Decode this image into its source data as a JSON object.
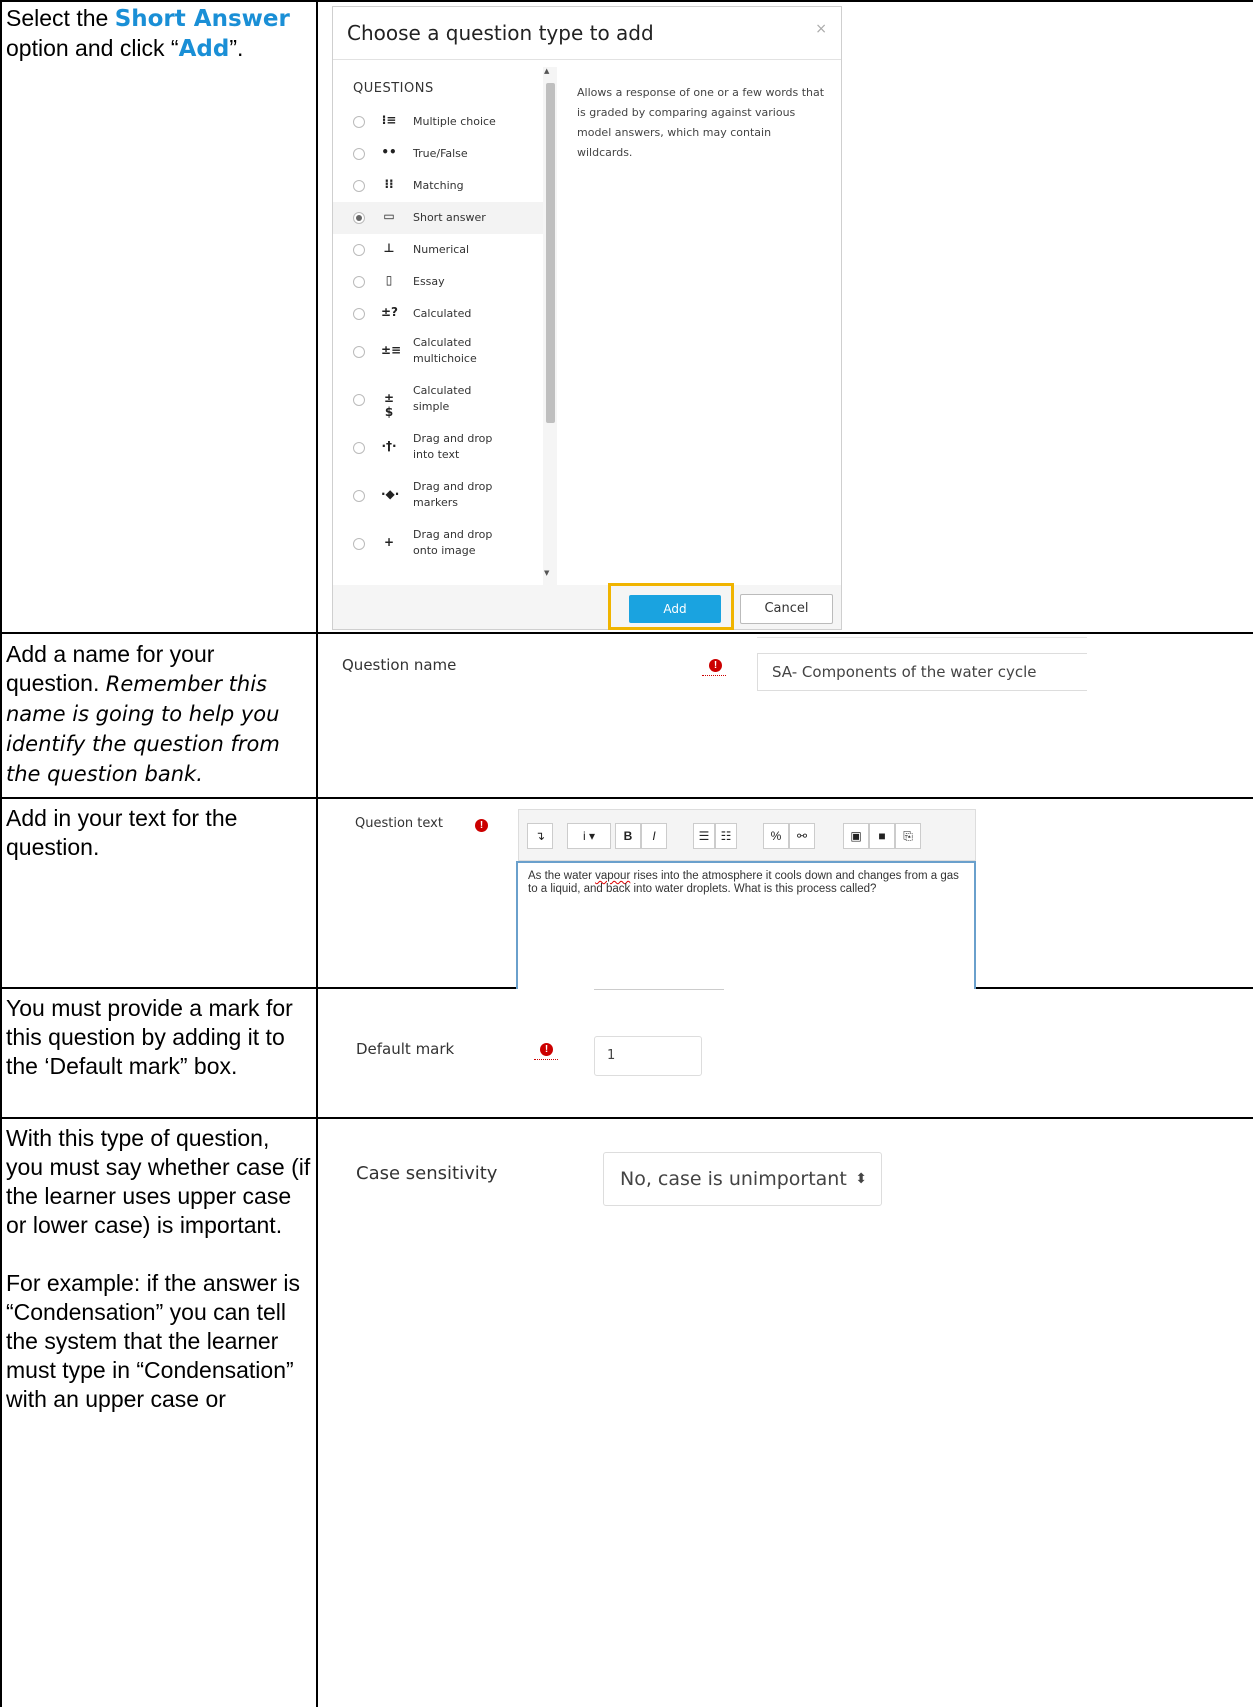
{
  "rows": {
    "r1": {
      "instr_prefix": "Select the ",
      "instr_highlight": "Short Answer",
      "instr_mid": " option and click “",
      "instr_add": "Add",
      "instr_suffix": "”."
    },
    "r2": {
      "instr_plain": "Add a name for your question. ",
      "instr_italic": "Remember this name is going to help you identify the question from the question bank."
    },
    "r3": {
      "instr": "Add in your text for the question."
    },
    "r4": {
      "instr": "You must provide a mark for this question by adding it to the ‘Default mark” box."
    },
    "r5": {
      "instr_p1": "With this type of question, you must say whether case (if the learner uses upper case or lower case) is important.",
      "instr_p2": "For example: if the answer is “Condensation” you can tell the system that the learner must type in “Condensation” with an upper case or"
    }
  },
  "modal": {
    "title": "Choose a question type to add",
    "close": "×",
    "section_heading": "QUESTIONS",
    "description": "Allows a response of one or a few words that is graded by comparing against various model answers, which may contain wildcards.",
    "items": [
      {
        "label": "Multiple choice",
        "icon": "multiple-choice-icon",
        "glyph": "⁝≡"
      },
      {
        "label": "True/False",
        "icon": "true-false-icon",
        "glyph": "••"
      },
      {
        "label": "Matching",
        "icon": "matching-icon",
        "glyph": "⁝⁝"
      },
      {
        "label": "Short answer",
        "icon": "short-answer-icon",
        "glyph": "▭",
        "selected": true
      },
      {
        "label": "Numerical",
        "icon": "numerical-icon",
        "glyph": "⊥"
      },
      {
        "label": "Essay",
        "icon": "essay-icon",
        "glyph": "▯"
      },
      {
        "label": "Calculated",
        "icon": "calculated-icon",
        "glyph": "±?"
      },
      {
        "label": "Calculated multichoice",
        "icon": "calculated-multichoice-icon",
        "glyph": "±≡"
      },
      {
        "label": "Calculated simple",
        "icon": "calculated-simple-icon",
        "glyph": "±$"
      },
      {
        "label": "Drag and drop into text",
        "icon": "drag-drop-text-icon",
        "glyph": "·†·"
      },
      {
        "label": "Drag and drop markers",
        "icon": "drag-drop-markers-icon",
        "glyph": "·◆·"
      },
      {
        "label": "Drag and drop onto image",
        "icon": "drag-drop-image-icon",
        "glyph": "+"
      }
    ],
    "add_label": "Add",
    "cancel_label": "Cancel"
  },
  "question_name": {
    "label": "Question name",
    "value": "SA- Components of the water cycle"
  },
  "question_text": {
    "label": "Question text",
    "text_before": "As the water ",
    "text_misspelled": "vapour",
    "text_after": " rises into the atmosphere it cools down and changes from a gas to a liquid, and back into water droplets. What is this process called?",
    "toolbar": [
      {
        "glyph": "↴",
        "name": "show-more-icon"
      },
      {
        "glyph": "i ▾",
        "name": "paragraph-style-icon"
      },
      {
        "glyph": "B",
        "name": "bold-icon"
      },
      {
        "glyph": "I",
        "name": "italic-icon"
      },
      {
        "glyph": "☰",
        "name": "unordered-list-icon"
      },
      {
        "glyph": "☷",
        "name": "ordered-list-icon"
      },
      {
        "glyph": "%",
        "name": "link-icon"
      },
      {
        "glyph": "⚯",
        "name": "unlink-icon"
      },
      {
        "glyph": "▣",
        "name": "image-icon"
      },
      {
        "glyph": "■",
        "name": "media-icon"
      },
      {
        "glyph": "⎘",
        "name": "manage-files-icon"
      }
    ]
  },
  "default_mark": {
    "label": "Default mark",
    "value": "1"
  },
  "case_sensitivity": {
    "label": "Case sensitivity",
    "value": "No, case is unimportant",
    "arrow": "⬍"
  },
  "colors": {
    "accent": "#1a8fd6",
    "button": "#1aa3e0",
    "highlight_box": "#f0b400",
    "error": "#cc0000"
  }
}
